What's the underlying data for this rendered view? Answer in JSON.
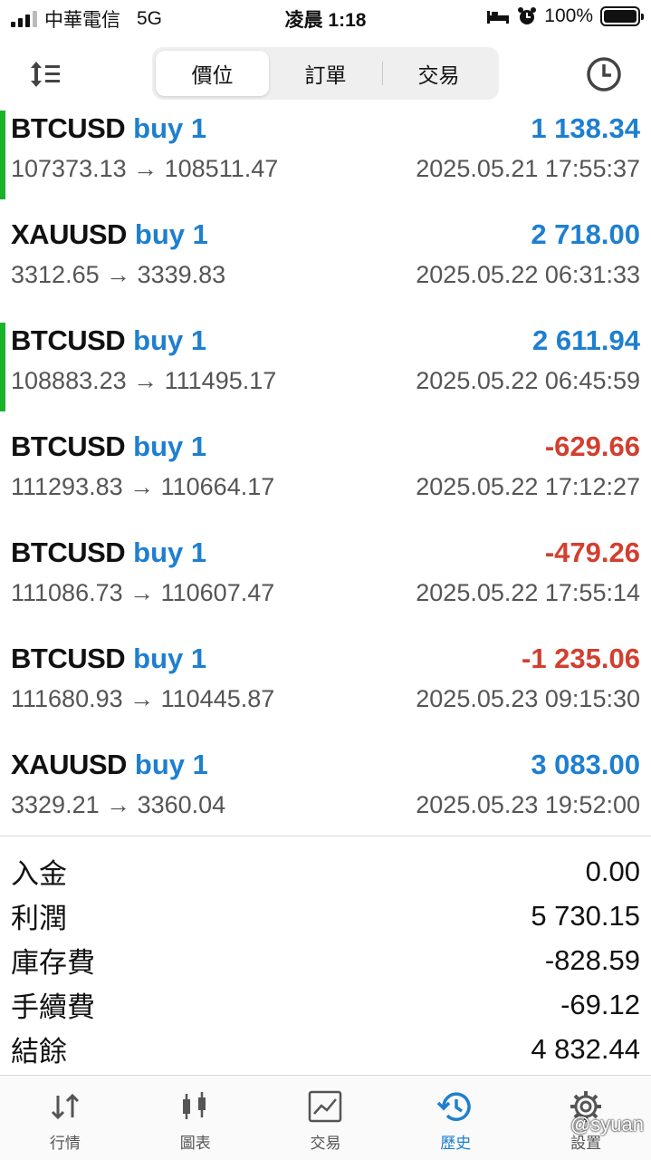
{
  "status_bar": {
    "carrier": "中華電信",
    "network": "5G",
    "time": "凌晨 1:18",
    "battery": "100%"
  },
  "toolbar": {
    "tabs": [
      {
        "label": "價位"
      },
      {
        "label": "訂單"
      },
      {
        "label": "交易"
      }
    ],
    "active_tab": "價位"
  },
  "trades": [
    {
      "symbol": "BTCUSD",
      "side": "buy 1",
      "prices": "107373.13 → 108511.47",
      "time": "2025.05.21 17:55:37",
      "profit": "1 138.34",
      "profit_sign": "pos",
      "accent": true
    },
    {
      "symbol": "XAUUSD",
      "side": "buy 1",
      "prices": "3312.65 → 3339.83",
      "time": "2025.05.22 06:31:33",
      "profit": "2 718.00",
      "profit_sign": "pos",
      "accent": false
    },
    {
      "symbol": "BTCUSD",
      "side": "buy 1",
      "prices": "108883.23 → 111495.17",
      "time": "2025.05.22 06:45:59",
      "profit": "2 611.94",
      "profit_sign": "pos",
      "accent": true
    },
    {
      "symbol": "BTCUSD",
      "side": "buy 1",
      "prices": "111293.83 → 110664.17",
      "time": "2025.05.22 17:12:27",
      "profit": "-629.66",
      "profit_sign": "neg",
      "accent": false
    },
    {
      "symbol": "BTCUSD",
      "side": "buy 1",
      "prices": "111086.73 → 110607.47",
      "time": "2025.05.22 17:55:14",
      "profit": "-479.26",
      "profit_sign": "neg",
      "accent": false
    },
    {
      "symbol": "BTCUSD",
      "side": "buy 1",
      "prices": "111680.93 → 110445.87",
      "time": "2025.05.23 09:15:30",
      "profit": "-1 235.06",
      "profit_sign": "neg",
      "accent": false
    },
    {
      "symbol": "XAUUSD",
      "side": "buy 1",
      "prices": "3329.21 → 3360.04",
      "time": "2025.05.23 19:52:00",
      "profit": "3 083.00",
      "profit_sign": "pos",
      "accent": false
    }
  ],
  "summary": [
    {
      "label": "入金",
      "value": "0.00"
    },
    {
      "label": "利潤",
      "value": "5 730.15"
    },
    {
      "label": "庫存費",
      "value": "-828.59"
    },
    {
      "label": "手續費",
      "value": "-69.12"
    },
    {
      "label": "結餘",
      "value": "4 832.44"
    }
  ],
  "tabbar": [
    {
      "label": "行情",
      "icon": "quotes-arrows-icon"
    },
    {
      "label": "圖表",
      "icon": "candlestick-chart-icon"
    },
    {
      "label": "交易",
      "icon": "trade-chart-icon"
    },
    {
      "label": "歷史",
      "icon": "history-clock-icon"
    },
    {
      "label": "設置",
      "icon": "gear-icon"
    }
  ],
  "active_bottom_tab": "歷史",
  "watermark": "@syuan",
  "colors": {
    "accent_blue": "#1e7fd0",
    "loss_red": "#d23f2f",
    "open_green": "#19b22b"
  }
}
